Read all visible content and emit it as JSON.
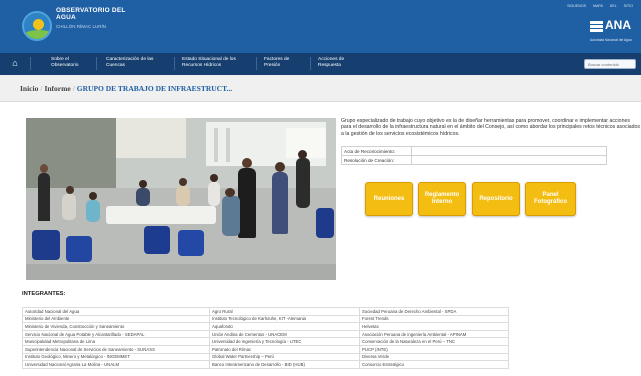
{
  "header": {
    "logo_title": "OBSERVATORIO DEL AGUA",
    "logo_sub": "CHILLÓN RÍMAC LURÍN",
    "top_links": "SIGUENOS   MAPA DEL SITIO",
    "ana_name": "ANA",
    "ana_sub": "Autoridad Nacional del Agua"
  },
  "nav": {
    "items": [
      "Sobre el Observatorio",
      "Caracterización de las Cuencas",
      "Estado Situacional de los Recursos Hídricos",
      "Factores de Presión",
      "Acciones de Respuesta"
    ],
    "search_placeholder": "Buscar contenido"
  },
  "breadcrumb": {
    "home": "Inicio",
    "section": "Informe",
    "current": "GRUPO DE TRABAJO DE INFRAESTRUCT..."
  },
  "description": "Grupo especializado de trabajo cuyo objetivo es la de diseñar herramientas para promover, coordinar e implementar acciones para el desarrollo de la infraestructura natural en el ámbito del Consejo, así como abordar los principales retos técnicos asociados a la gestión de los servicios ecosistémicos hídricos.",
  "info_table": [
    {
      "label": "Acta de Reconocimiento:",
      "value": ""
    },
    {
      "label": "Resolución de Creación:",
      "value": ""
    }
  ],
  "buttons": [
    "Reuniones",
    "Reglamento Interno",
    "Repositorio",
    "Panel Fotográfico"
  ],
  "colors": {
    "header_blue": "#1f5fa3",
    "nav_blue": "#163f6f",
    "button_yellow": "#f4bd11"
  },
  "members_title": "INTEGRANTES:",
  "members": [
    [
      "Autoridad Nacional del Agua",
      "Agro Rural",
      "Sociedad Peruana de Derecho Ambiental - SPDA"
    ],
    [
      "Ministerio del Ambiente",
      "Instituto Tecnológico de Karlsruhe, KIT -Alemania",
      "Forest Trends"
    ],
    [
      "Ministerio de Vivienda, Construcción y Saneamiento",
      "Aquafondo",
      "Helvetas"
    ],
    [
      "Servicio Nacional de Agua Potable y Alcantarillado - SEDAPAL",
      "Unión Andina de Cementos - UNACEM",
      "Asociación Peruana de ingeniería Ambiental - APINAM"
    ],
    [
      "Municipalidad Metropolitana de Lima",
      "Universidad de ingeniería y Tecnología - UTEC",
      "Conservación de la Naturaleza en el Perú – TNC"
    ],
    [
      "Superintendencia Nacional de Servicios de Saneamiento - SUNASS",
      "Patronato del Rímac",
      "PUCP (INTE)"
    ],
    [
      "Instituto Geológico, Minero y Metalúrgico - INGEMMET",
      "Global Water Partnership – Perú",
      "Diversa Verde"
    ],
    [
      "Universidad Nacional Agraria La Molina - UNALM",
      "Banco Interamericano de Desarrollo - BID (HUB)",
      "Consorcio Estratégico"
    ]
  ]
}
